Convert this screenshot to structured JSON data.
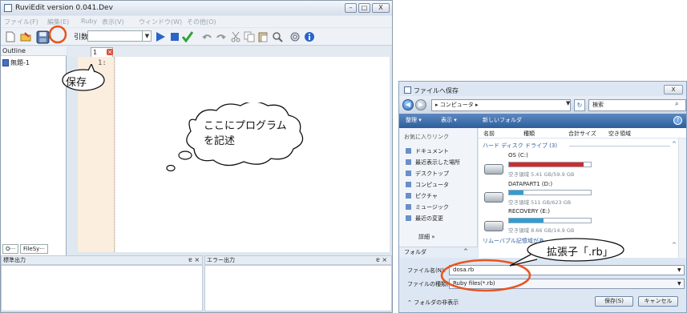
{
  "editor": {
    "title": "RuviEdit version 0.041.Dev",
    "window_buttons": [
      "–",
      "□",
      "X"
    ],
    "menu": [
      "ファイル(F)",
      "編集(E)",
      "Ruby",
      "表示(V)",
      "ウィンドウ(W)",
      "その他(O)"
    ],
    "args_label": "引数:",
    "outline_title": "Outline",
    "outline_item": "無題-1",
    "outline_tabs": [
      "O···",
      "FileSy···"
    ],
    "tab_label": "1",
    "line_number": "1:",
    "stdout_title": "標準出力",
    "stderr_title": "エラー出力",
    "pane_controls": "ɐ ×",
    "accent_run": "#2a64c8",
    "accent_ok": "#2fa33a"
  },
  "dialog": {
    "title": "ファイルへ保存",
    "close": "X",
    "address": "▸ コンピュータ ▸",
    "search_placeholder": "検索",
    "commands": [
      "整理 ▾",
      "表示 ▾",
      "新しいフォルダ"
    ],
    "help": "?",
    "favorites_heading": "お気に入りリンク",
    "nav_items": [
      "ドキュメント",
      "最近表示した場所",
      "デスクトップ",
      "コンピュータ",
      "ピクチャ",
      "ミュージック",
      "最近の変更"
    ],
    "more": "詳細 »",
    "folders": "フォルダ",
    "columns": [
      "名前",
      "種類",
      "合計サイズ",
      "空き領域"
    ],
    "hdd_group": "ハード ディスク ドライブ (3)",
    "removable_group": "リムーバブル記憶域があ",
    "drives": [
      {
        "name": "OS (C:)",
        "free": "空き領域 5.41 GB/59.9 GB",
        "used": 0.91,
        "color": "#d42a2a"
      },
      {
        "name": "DATAPART1 (D:)",
        "free": "空き領域 511 GB/623 GB",
        "used": 0.18,
        "color": "#2b9fd6"
      },
      {
        "name": "RECOVERY (E:)",
        "free": "空き領域 8.66 GB/14.9 GB",
        "used": 0.42,
        "color": "#2b9fd6"
      }
    ],
    "filename_label": "ファイル名(N):",
    "filename_value": "dosa.rb",
    "filetype_label": "ファイルの種類(T):",
    "filetype_value": "Ruby files(*.rb)",
    "hide_folders": "フォルダの非表示",
    "save_button": "保存(S)",
    "cancel_button": "キャンセル"
  },
  "annotations": {
    "save": "保存",
    "program": "ここにプログラム",
    "program2": "を記述",
    "extension": "拡張子「.rb」",
    "highlight_color": "#e8541e"
  }
}
